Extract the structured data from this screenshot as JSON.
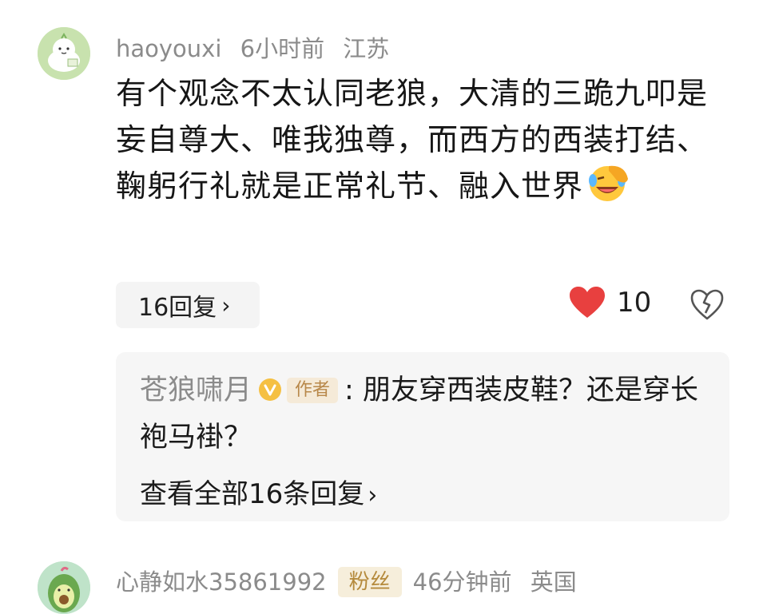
{
  "comment1": {
    "username": "haoyouxi",
    "time": "6小时前",
    "location": "江苏",
    "body": "有个观念不太认同老狼，大清的三跪九叩是妄自尊大、唯我独尊，而西方的西装打结、鞠躬行礼就是正常礼节、融入世界",
    "emoji_icon": "facepalm-laughing-emoji",
    "reply_count_label": "16回复",
    "like_count": "10",
    "liked": true,
    "accent": "#e8403f"
  },
  "reply": {
    "author": "苍狼啸月",
    "author_tag": "作者",
    "separator": ":",
    "text": "朋友穿西装皮鞋？还是穿长袍马褂？",
    "view_all_label": "查看全部16条回复"
  },
  "comment2": {
    "username": "心静如水35861992",
    "badge": "粉丝",
    "time": "46分钟前",
    "location": "英国"
  }
}
